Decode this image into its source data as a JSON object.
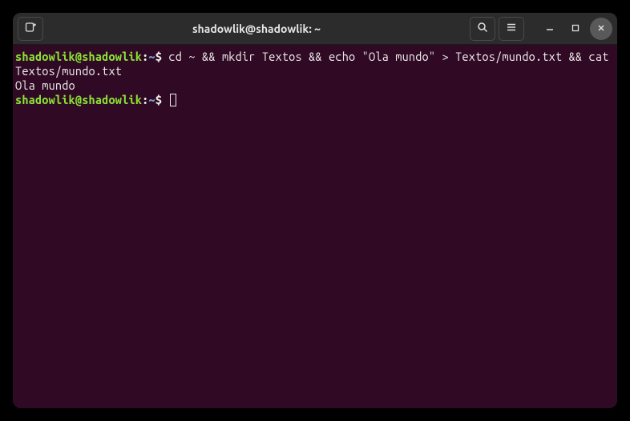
{
  "window": {
    "title": "shadowlik@shadowlik: ~"
  },
  "terminal": {
    "line1": {
      "user_host": "shadowlik@shadowlik",
      "colon": ":",
      "path": "~",
      "prompt": "$",
      "command": " cd ~ && mkdir Textos && echo \"Ola mundo\" > Textos/mundo.txt && cat Textos/mundo.txt"
    },
    "output": "Ola mundo",
    "line2": {
      "user_host": "shadowlik@shadowlik",
      "colon": ":",
      "path": "~",
      "prompt": "$"
    }
  },
  "icons": {
    "new_tab": "new-tab",
    "search": "search",
    "menu": "menu",
    "minimize": "minimize",
    "maximize": "maximize",
    "close": "close"
  }
}
